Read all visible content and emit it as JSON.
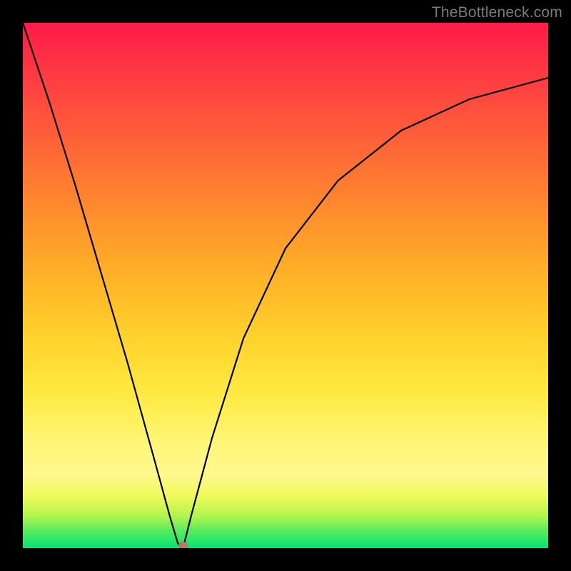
{
  "watermark": "TheBottleneck.com",
  "chart_data": {
    "type": "line",
    "title": "",
    "xlabel": "",
    "ylabel": "",
    "xlim": [
      0,
      100
    ],
    "ylim": [
      0,
      100
    ],
    "grid": false,
    "series": [
      {
        "name": "bottleneck-curve",
        "x": [
          0,
          5,
          10,
          15,
          20,
          25,
          28,
          29.5,
          30.5,
          32,
          36,
          42,
          50,
          60,
          72,
          85,
          100
        ],
        "y": [
          100,
          85,
          69,
          52,
          35,
          17,
          6,
          1,
          1,
          6,
          21,
          40,
          57,
          70,
          79.5,
          85.5,
          89.5
        ]
      }
    ],
    "marker": {
      "name": "optimal-point",
      "x": 30.5,
      "y": 0,
      "color": "#bd7464"
    },
    "background_gradient": {
      "top": "#ff1a4a",
      "mid": "#ffe93f",
      "bottom": "#00e571"
    }
  }
}
